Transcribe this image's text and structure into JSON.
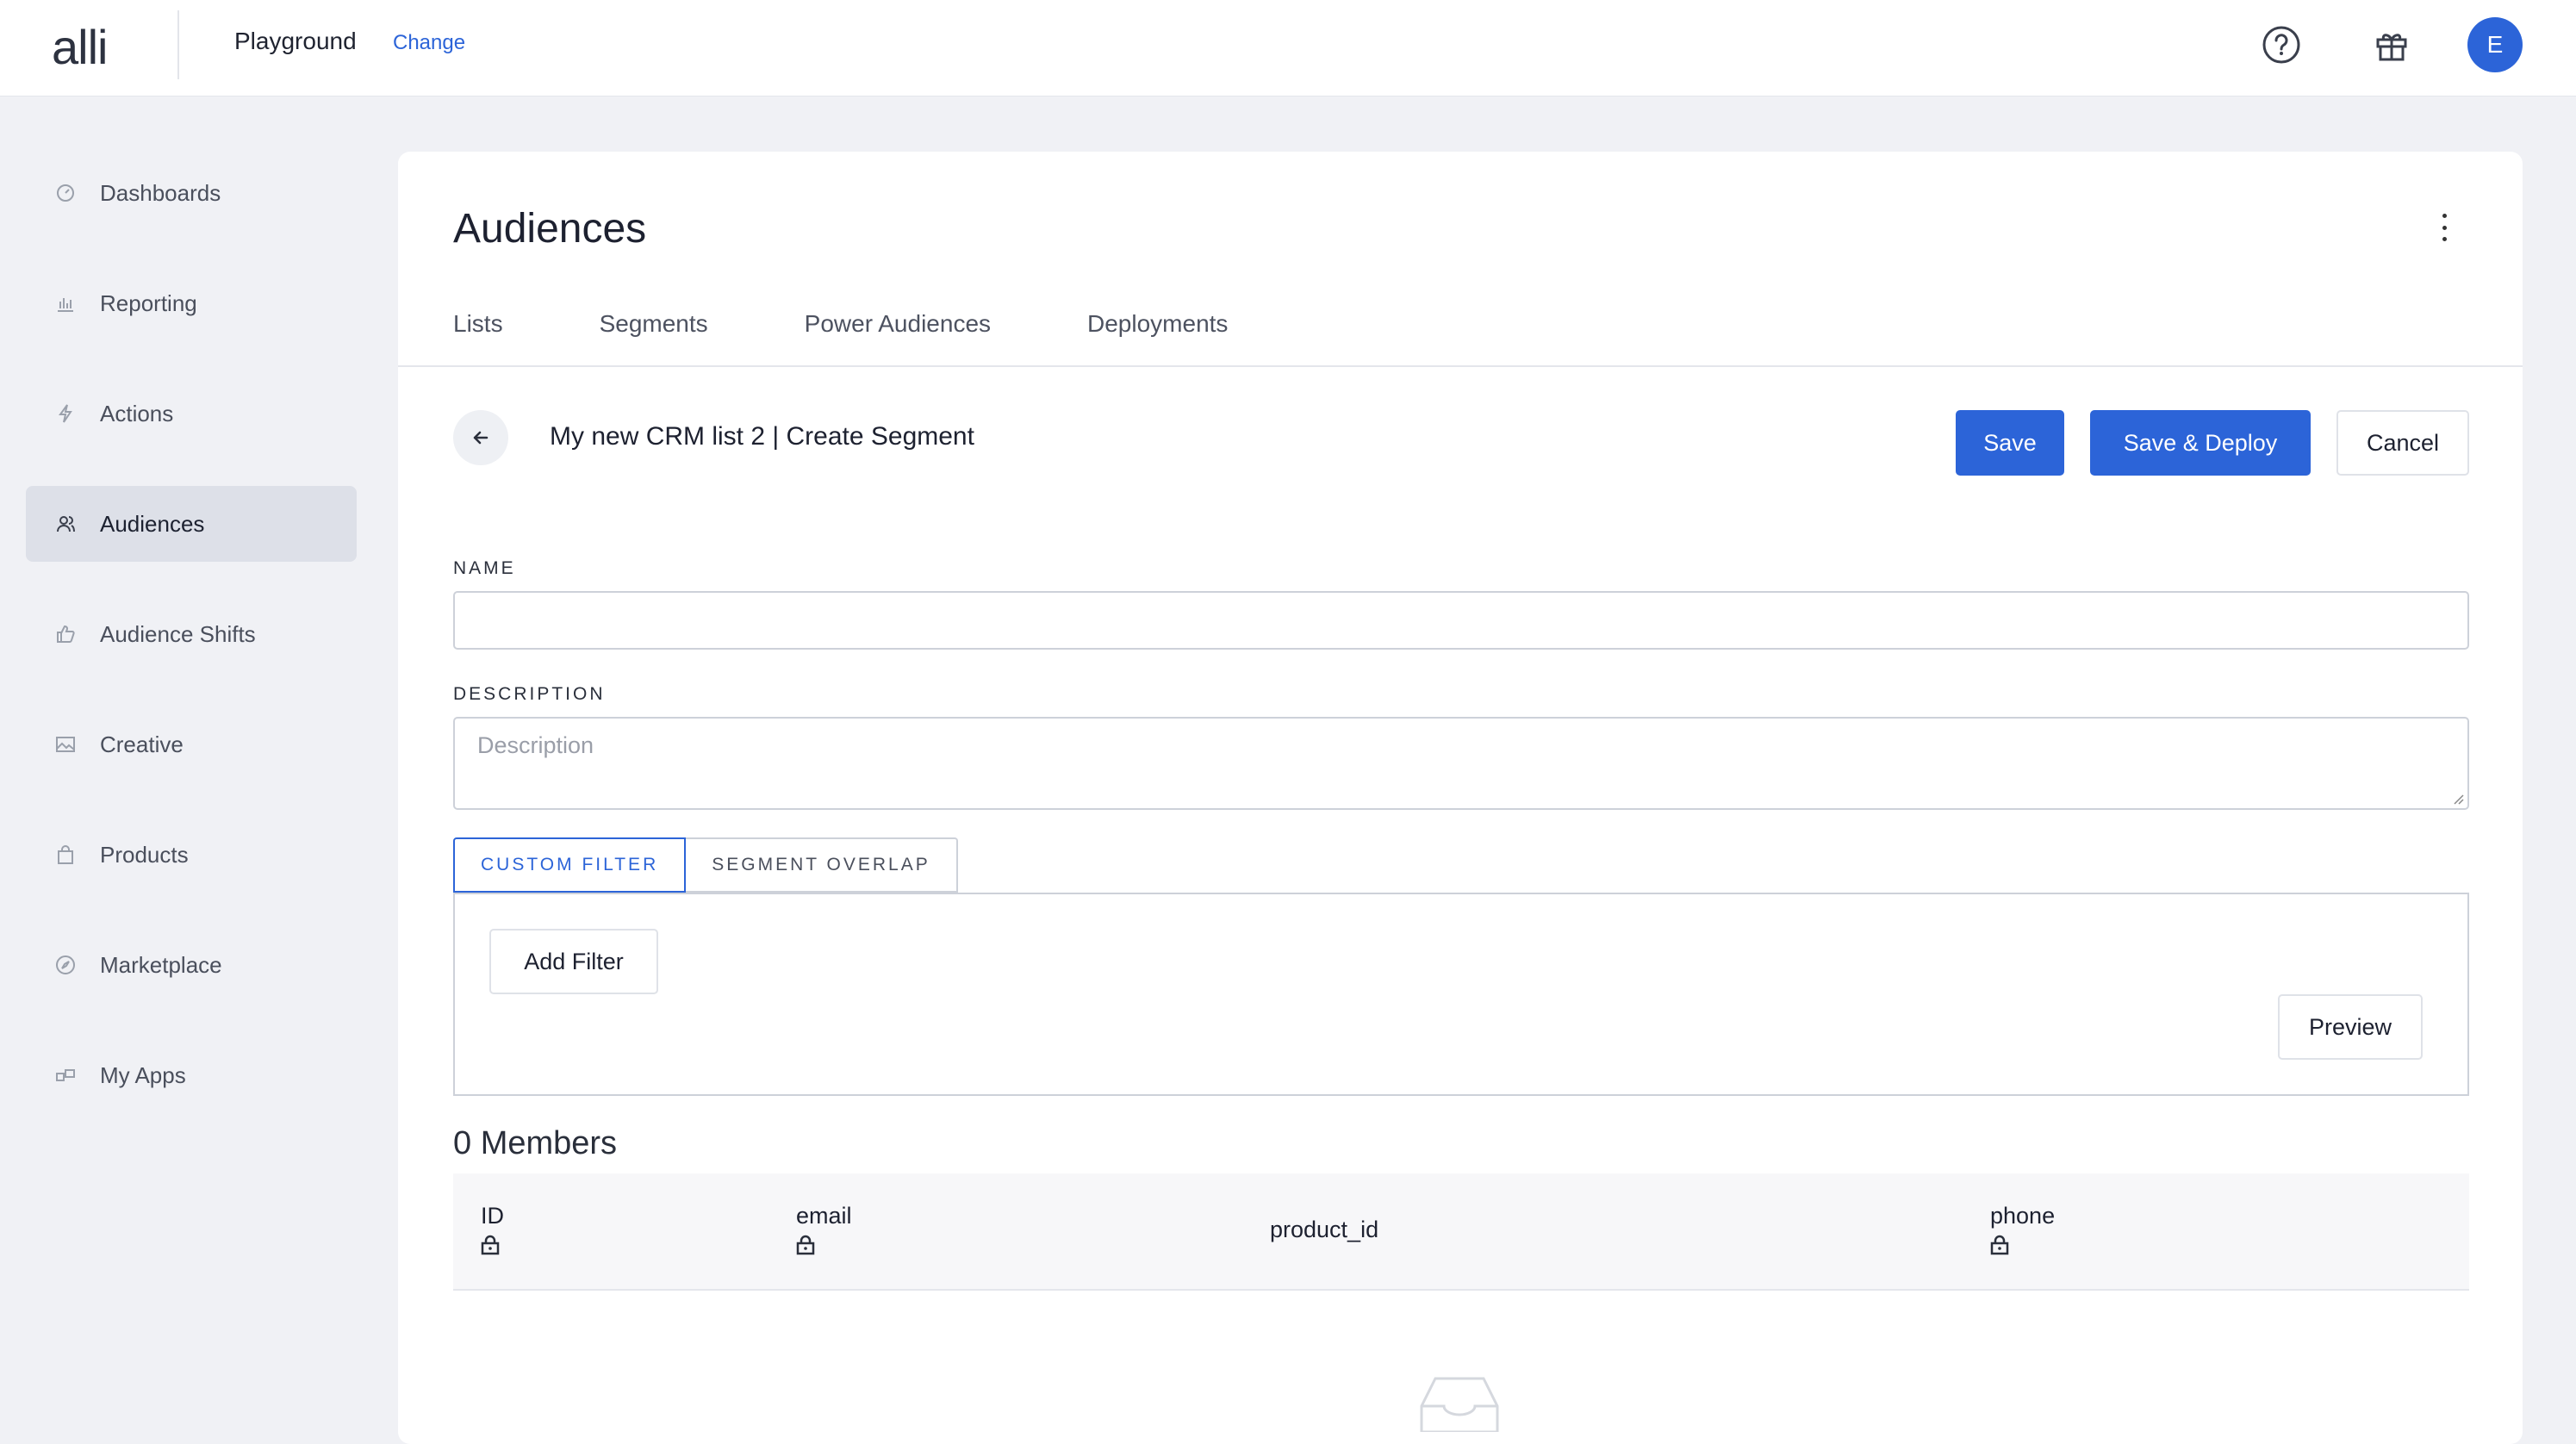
{
  "header": {
    "logo": "alli",
    "workspace": "Playground",
    "change_link": "Change",
    "avatar_initial": "E"
  },
  "sidebar": {
    "items": [
      {
        "label": "Dashboards",
        "icon": "gauge-icon"
      },
      {
        "label": "Reporting",
        "icon": "bar-chart-icon"
      },
      {
        "label": "Actions",
        "icon": "lightning-icon"
      },
      {
        "label": "Audiences",
        "icon": "users-icon",
        "active": true
      },
      {
        "label": "Audience Shifts",
        "icon": "thumbs-up-icon"
      },
      {
        "label": "Creative",
        "icon": "image-icon"
      },
      {
        "label": "Products",
        "icon": "bag-icon"
      },
      {
        "label": "Marketplace",
        "icon": "compass-icon"
      },
      {
        "label": "My Apps",
        "icon": "apps-icon"
      }
    ]
  },
  "main": {
    "title": "Audiences",
    "tabs": [
      "Lists",
      "Segments",
      "Power Audiences",
      "Deployments"
    ],
    "segment_title": "My new CRM list 2 | Create Segment",
    "buttons": {
      "save": "Save",
      "save_deploy": "Save & Deploy",
      "cancel": "Cancel",
      "add_filter": "Add Filter",
      "preview": "Preview"
    },
    "form": {
      "name_label": "NAME",
      "name_value": "",
      "description_label": "DESCRIPTION",
      "description_placeholder": "Description"
    },
    "filter_tabs": [
      "CUSTOM FILTER",
      "SEGMENT OVERLAP"
    ],
    "members_count": "0 Members",
    "table": {
      "columns": [
        {
          "label": "ID",
          "locked": true
        },
        {
          "label": "email",
          "locked": true
        },
        {
          "label": "product_id",
          "locked": false
        },
        {
          "label": "phone",
          "locked": true
        }
      ]
    }
  },
  "colors": {
    "accent": "#2c64d8",
    "background": "#f0f1f5",
    "sidebar_active": "#dde0e8"
  }
}
